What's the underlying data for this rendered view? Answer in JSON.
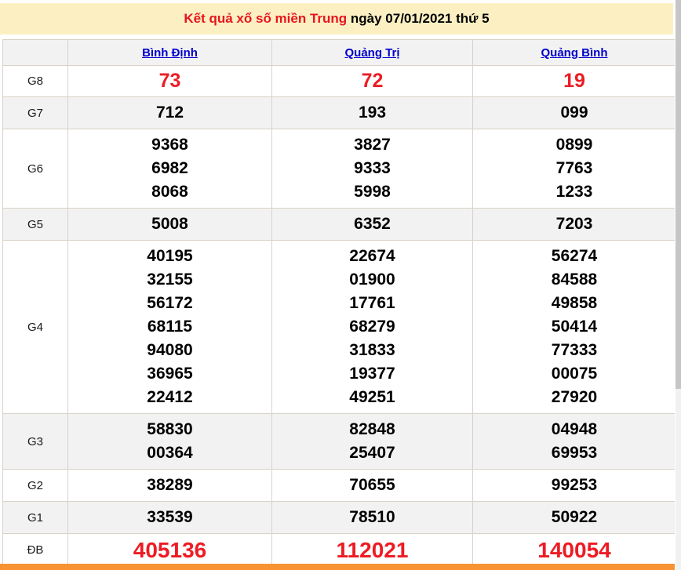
{
  "banner": {
    "title_red": "Kết quả xổ số miền Trung",
    "title_black": " ngày 07/01/2021 thứ 5"
  },
  "table": {
    "columns": [
      "Bình Định",
      "Quảng Trị",
      "Quảng Bình"
    ],
    "rows": [
      {
        "label": "G8",
        "values": [
          [
            "73"
          ],
          [
            "72"
          ],
          [
            "19"
          ]
        ]
      },
      {
        "label": "G7",
        "values": [
          [
            "712"
          ],
          [
            "193"
          ],
          [
            "099"
          ]
        ]
      },
      {
        "label": "G6",
        "values": [
          [
            "9368",
            "6982",
            "8068"
          ],
          [
            "3827",
            "9333",
            "5998"
          ],
          [
            "0899",
            "7763",
            "1233"
          ]
        ]
      },
      {
        "label": "G5",
        "values": [
          [
            "5008"
          ],
          [
            "6352"
          ],
          [
            "7203"
          ]
        ]
      },
      {
        "label": "G4",
        "values": [
          [
            "40195",
            "32155",
            "56172",
            "68115",
            "94080",
            "36965",
            "22412"
          ],
          [
            "22674",
            "01900",
            "17761",
            "68279",
            "31833",
            "19377",
            "49251"
          ],
          [
            "56274",
            "84588",
            "49858",
            "50414",
            "77333",
            "00075",
            "27920"
          ]
        ]
      },
      {
        "label": "G3",
        "values": [
          [
            "58830",
            "00364"
          ],
          [
            "82848",
            "25407"
          ],
          [
            "04948",
            "69953"
          ]
        ]
      },
      {
        "label": "G2",
        "values": [
          [
            "38289"
          ],
          [
            "70655"
          ],
          [
            "99253"
          ]
        ]
      },
      {
        "label": "G1",
        "values": [
          [
            "33539"
          ],
          [
            "78510"
          ],
          [
            "50922"
          ]
        ]
      },
      {
        "label": "ĐB",
        "values": [
          [
            "405136"
          ],
          [
            "112021"
          ],
          [
            "140054"
          ]
        ]
      }
    ]
  },
  "colors": {
    "banner_bg": "#FCF0C3",
    "title_accent": "#e8151d",
    "result_highlight": "#ed1c24",
    "header_link": "#0000cc",
    "row_alt_bg": "#f2f2f2",
    "table_border": "#d9d2c7",
    "bottom_bar": "#f79332"
  }
}
